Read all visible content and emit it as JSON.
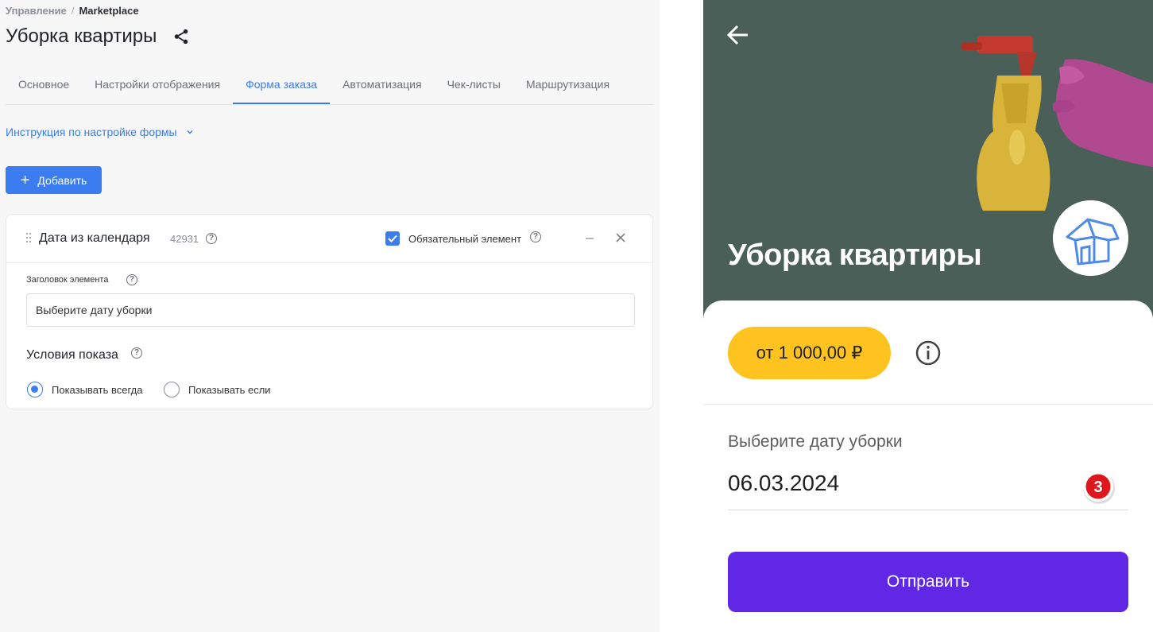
{
  "admin": {
    "breadcrumb": {
      "root": "Управление",
      "separator": "/",
      "current": "Marketplace"
    },
    "title": "Уборка квартиры",
    "tabs": [
      {
        "label": "Основное",
        "active": false
      },
      {
        "label": "Настройки отображения",
        "active": false
      },
      {
        "label": "Форма заказа",
        "active": true
      },
      {
        "label": "Автоматизация",
        "active": false
      },
      {
        "label": "Чек-листы",
        "active": false
      },
      {
        "label": "Маршрутизация",
        "active": false
      }
    ],
    "instruction_link": "Инструкция по настройке формы",
    "add_button": "Добавить",
    "field_card": {
      "name": "Дата из календаря",
      "id": "42931",
      "required_label": "Обязательный элемент",
      "required_checked": true,
      "element_title_label": "Заголовок элемента",
      "element_title_value": "Выберите дату уборки",
      "conditions_title": "Условия показа",
      "radio_options": [
        {
          "label": "Показывать всегда",
          "selected": true
        },
        {
          "label": "Показывать если",
          "selected": false
        }
      ]
    },
    "help_glyph": "?",
    "accent_color": "#3b7cf0"
  },
  "preview": {
    "title": "Уборка квартиры",
    "price": "от 1 000,00 ₽",
    "date_label": "Выберите дату уборки",
    "date_value": "06.03.2024",
    "step_marker": "3",
    "submit_button": "Отправить",
    "colors": {
      "hero_bg": "#4a5f58",
      "price_bg": "#fec31f",
      "submit_bg": "#6028e5",
      "marker": "#e0161e"
    },
    "icons": [
      "back-arrow-icon",
      "house-icon",
      "info-icon"
    ]
  }
}
